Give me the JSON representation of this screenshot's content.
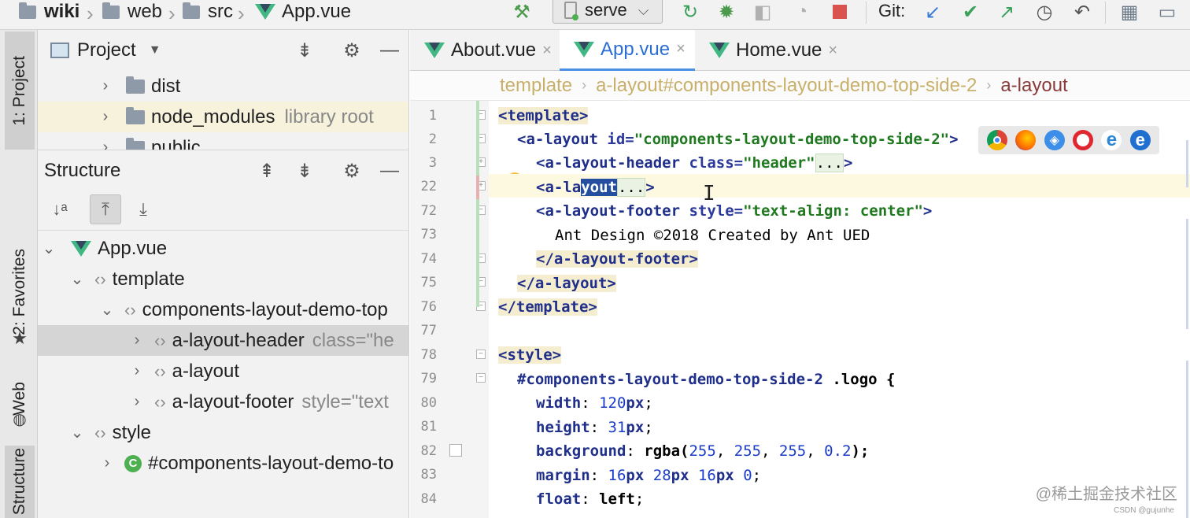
{
  "breadcrumb_nav": {
    "items": [
      "wiki",
      "web",
      "src",
      "App.vue"
    ]
  },
  "toolbar": {
    "run_config": "serve",
    "git_label": "Git:",
    "icons": [
      "build-hammer-icon",
      "rerun-icon",
      "debug-bug-icon",
      "coverage-icon",
      "profile-icon",
      "stop-icon",
      "git-update-icon",
      "git-commit-icon",
      "git-push-icon",
      "history-icon",
      "rollback-icon",
      "project-structure-icon",
      "terminal-icon"
    ]
  },
  "left_strip": {
    "project": "1: Project",
    "favorites": "2: Favorites",
    "web": "Web",
    "structure": "Structure"
  },
  "project_panel": {
    "title": "Project",
    "items": [
      {
        "name": "dist",
        "note": ""
      },
      {
        "name": "node_modules",
        "note": "library root"
      },
      {
        "name": "public",
        "note": ""
      }
    ]
  },
  "structure_panel": {
    "title": "Structure",
    "rows": [
      {
        "label": "App.vue",
        "note": ""
      },
      {
        "label": "template",
        "note": ""
      },
      {
        "label": "components-layout-demo-top",
        "note": ""
      },
      {
        "label": "a-layout-header",
        "note": "class=\"he"
      },
      {
        "label": "a-layout",
        "note": ""
      },
      {
        "label": "a-layout-footer",
        "note": "style=\"text"
      },
      {
        "label": "style",
        "note": ""
      },
      {
        "label": "#components-layout-demo-to",
        "note": ""
      }
    ]
  },
  "editor": {
    "tabs": [
      {
        "label": "About.vue",
        "active": false
      },
      {
        "label": "App.vue",
        "active": true
      },
      {
        "label": "Home.vue",
        "active": false
      }
    ],
    "breadcrumbs": [
      "template",
      "a-layout#components-layout-demo-top-side-2",
      "a-layout"
    ],
    "line_numbers": [
      "1",
      "2",
      "3",
      "22",
      "72",
      "73",
      "74",
      "75",
      "76",
      "77",
      "78",
      "79",
      "80",
      "81",
      "82",
      "83",
      "84"
    ],
    "code": {
      "l1": "<template>",
      "l2_tag": "<a-layout",
      "l2_attr": " id=",
      "l2_val": "\"components-layout-demo-top-side-2\"",
      "l2_end": ">",
      "l3_tag": "<a-layout-header",
      "l3_attr": " class=",
      "l3_val": "\"header\"",
      "l3_ell": "...",
      "l3_end": ">",
      "l22_a": "<a-la",
      "l22_sel": "yout",
      "l22_ell": "...",
      "l22_end": ">",
      "l72_tag": "<a-layout-footer",
      "l72_attr": " style=",
      "l72_val": "\"text-align: center\"",
      "l72_end": ">",
      "l73": "Ant Design ©2018 Created by Ant UED",
      "l74": "</a-layout-footer>",
      "l75": "</a-layout>",
      "l76": "</template>",
      "l78": "<style>",
      "l79_sel": "#components-layout-demo-top-side-2",
      "l79_rest": " .logo {",
      "l80_prop": "width",
      "l80_val": "120",
      "l80_unit": "px",
      "l81_prop": "height",
      "l81_val": "31",
      "l81_unit": "px",
      "l82_prop": "background",
      "l82_fn": "rgba(",
      "l82_n1": "255",
      "l82_n2": "255",
      "l82_n3": "255",
      "l82_n4": "0.2",
      "l82_end": ");",
      "l83_prop": "margin",
      "l83_v1": "16",
      "l83_v2": "28",
      "l83_v3": "16",
      "l83_v4": "0",
      "l84_prop": "float",
      "l84_val": "left"
    }
  },
  "watermark": {
    "text": "@稀土掘金技术社区",
    "sub": "CSDN @gujunhe"
  },
  "colors": {
    "vue_green": "#41b883",
    "vue_dark": "#34495e",
    "accent_blue": "#2a6ed6",
    "selection": "#244f9e"
  }
}
